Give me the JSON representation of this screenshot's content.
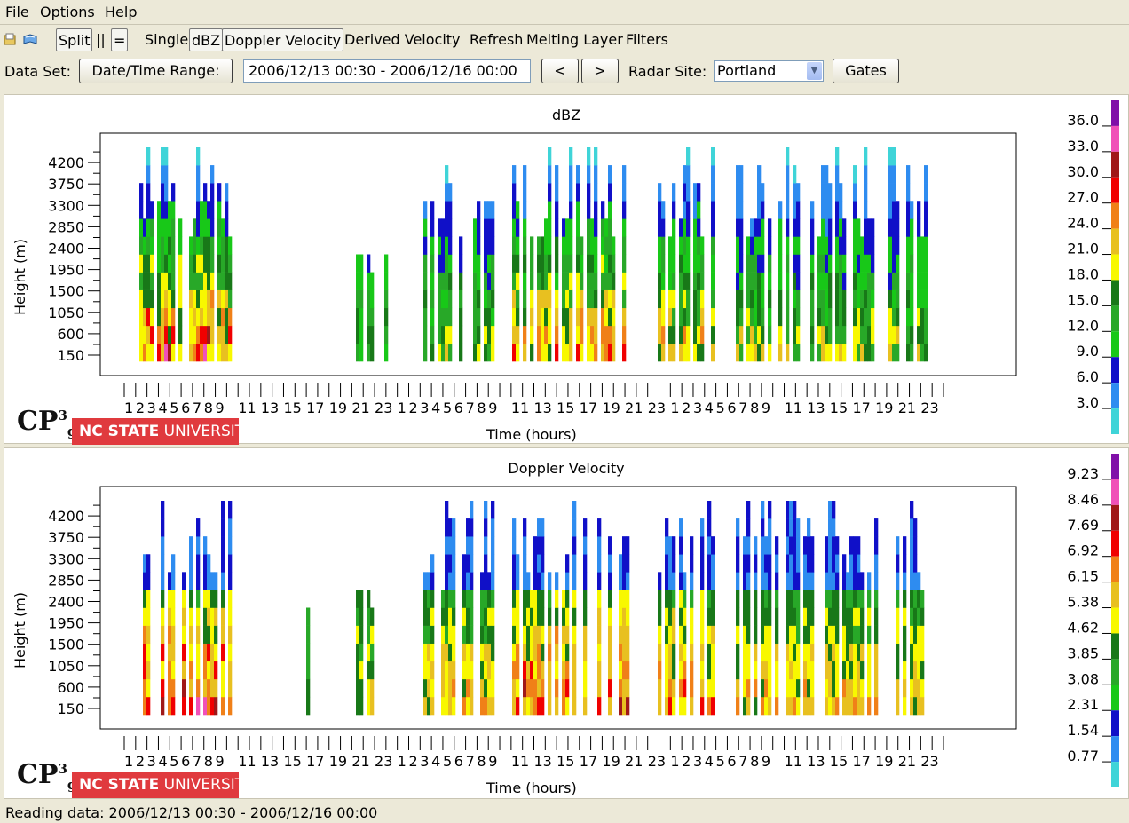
{
  "menubar": {
    "file": "File",
    "options": "Options",
    "help": "Help"
  },
  "toolbar": {
    "split": "Split",
    "pipe": "||",
    "equals": "=",
    "single": "Single",
    "dbz": "dBZ",
    "doppler": "Doppler Velocity",
    "derived": "Derived Velocity",
    "refresh": "Refresh",
    "melting": "Melting Layer",
    "filters": "Filters",
    "icons": [
      "open-file-icon",
      "open-book-icon"
    ]
  },
  "dataset": {
    "label": "Data Set:",
    "range_button": "Date/Time Range:",
    "range_value": "2006/12/13 00:30 - 2006/12/16 00:00",
    "prev": "<",
    "next": ">",
    "site_label": "Radar Site:",
    "site_value": "Portland",
    "gates": "Gates"
  },
  "logo": {
    "cp": "CP",
    "sup": "3",
    "sub": "g",
    "ncsu_bold": "NC STATE",
    "ncsu_light": "UNIVERSITY"
  },
  "status": "Reading data: 2006/12/13 00:30 - 2006/12/16 00:00",
  "colors": {
    "colorbar": [
      "#3fd4d8",
      "#2e8cf0",
      "#1010c8",
      "#18c818",
      "#28a828",
      "#187818",
      "#f8f800",
      "#e8c020",
      "#f08018",
      "#f00000",
      "#a01818",
      "#f050b8",
      "#8010a8"
    ]
  },
  "chart_data": [
    {
      "type": "heatmap",
      "title": "dBZ",
      "xlabel": "Time (hours)",
      "ylabel": "Height (m)",
      "yticks": [
        "150",
        "600",
        "1050",
        "1500",
        "1950",
        "2400",
        "2850",
        "3300",
        "3750",
        "4200"
      ],
      "xticks": [
        "1",
        "2",
        "3",
        "4",
        "5",
        "6",
        "7",
        "8",
        "9",
        "11",
        "13",
        "15",
        "17",
        "19",
        "21",
        "23",
        "1",
        "2",
        "3",
        "4",
        "5",
        "6",
        "7",
        "8",
        "9",
        "11",
        "13",
        "15",
        "17",
        "19",
        "21",
        "23",
        "1",
        "2",
        "3",
        "4",
        "5",
        "6",
        "7",
        "8",
        "9",
        "11",
        "13",
        "15",
        "17",
        "19",
        "21",
        "23"
      ],
      "colorbar_ticks": [
        "36.0",
        "33.0",
        "30.0",
        "27.0",
        "24.0",
        "21.0",
        "18.0",
        "15.0",
        "12.0",
        "9.0",
        "6.0",
        "3.0"
      ]
    },
    {
      "type": "heatmap",
      "title": "Doppler Velocity",
      "xlabel": "Time (hours)",
      "ylabel": "Height (m)",
      "yticks": [
        "150",
        "600",
        "1050",
        "1500",
        "1950",
        "2400",
        "2850",
        "3300",
        "3750",
        "4200"
      ],
      "xticks": [
        "1",
        "2",
        "3",
        "4",
        "5",
        "6",
        "7",
        "8",
        "9",
        "11",
        "13",
        "15",
        "17",
        "19",
        "21",
        "23",
        "1",
        "2",
        "3",
        "4",
        "5",
        "6",
        "7",
        "8",
        "9",
        "11",
        "13",
        "15",
        "17",
        "19",
        "21",
        "23",
        "1",
        "2",
        "3",
        "4",
        "5",
        "6",
        "7",
        "8",
        "9",
        "11",
        "13",
        "15",
        "17",
        "19",
        "21",
        "23"
      ],
      "colorbar_ticks": [
        "9.23",
        "8.46",
        "7.69",
        "6.92",
        "6.15",
        "5.38",
        "4.62",
        "3.85",
        "3.08",
        "2.31",
        "1.54",
        "0.77"
      ]
    }
  ]
}
